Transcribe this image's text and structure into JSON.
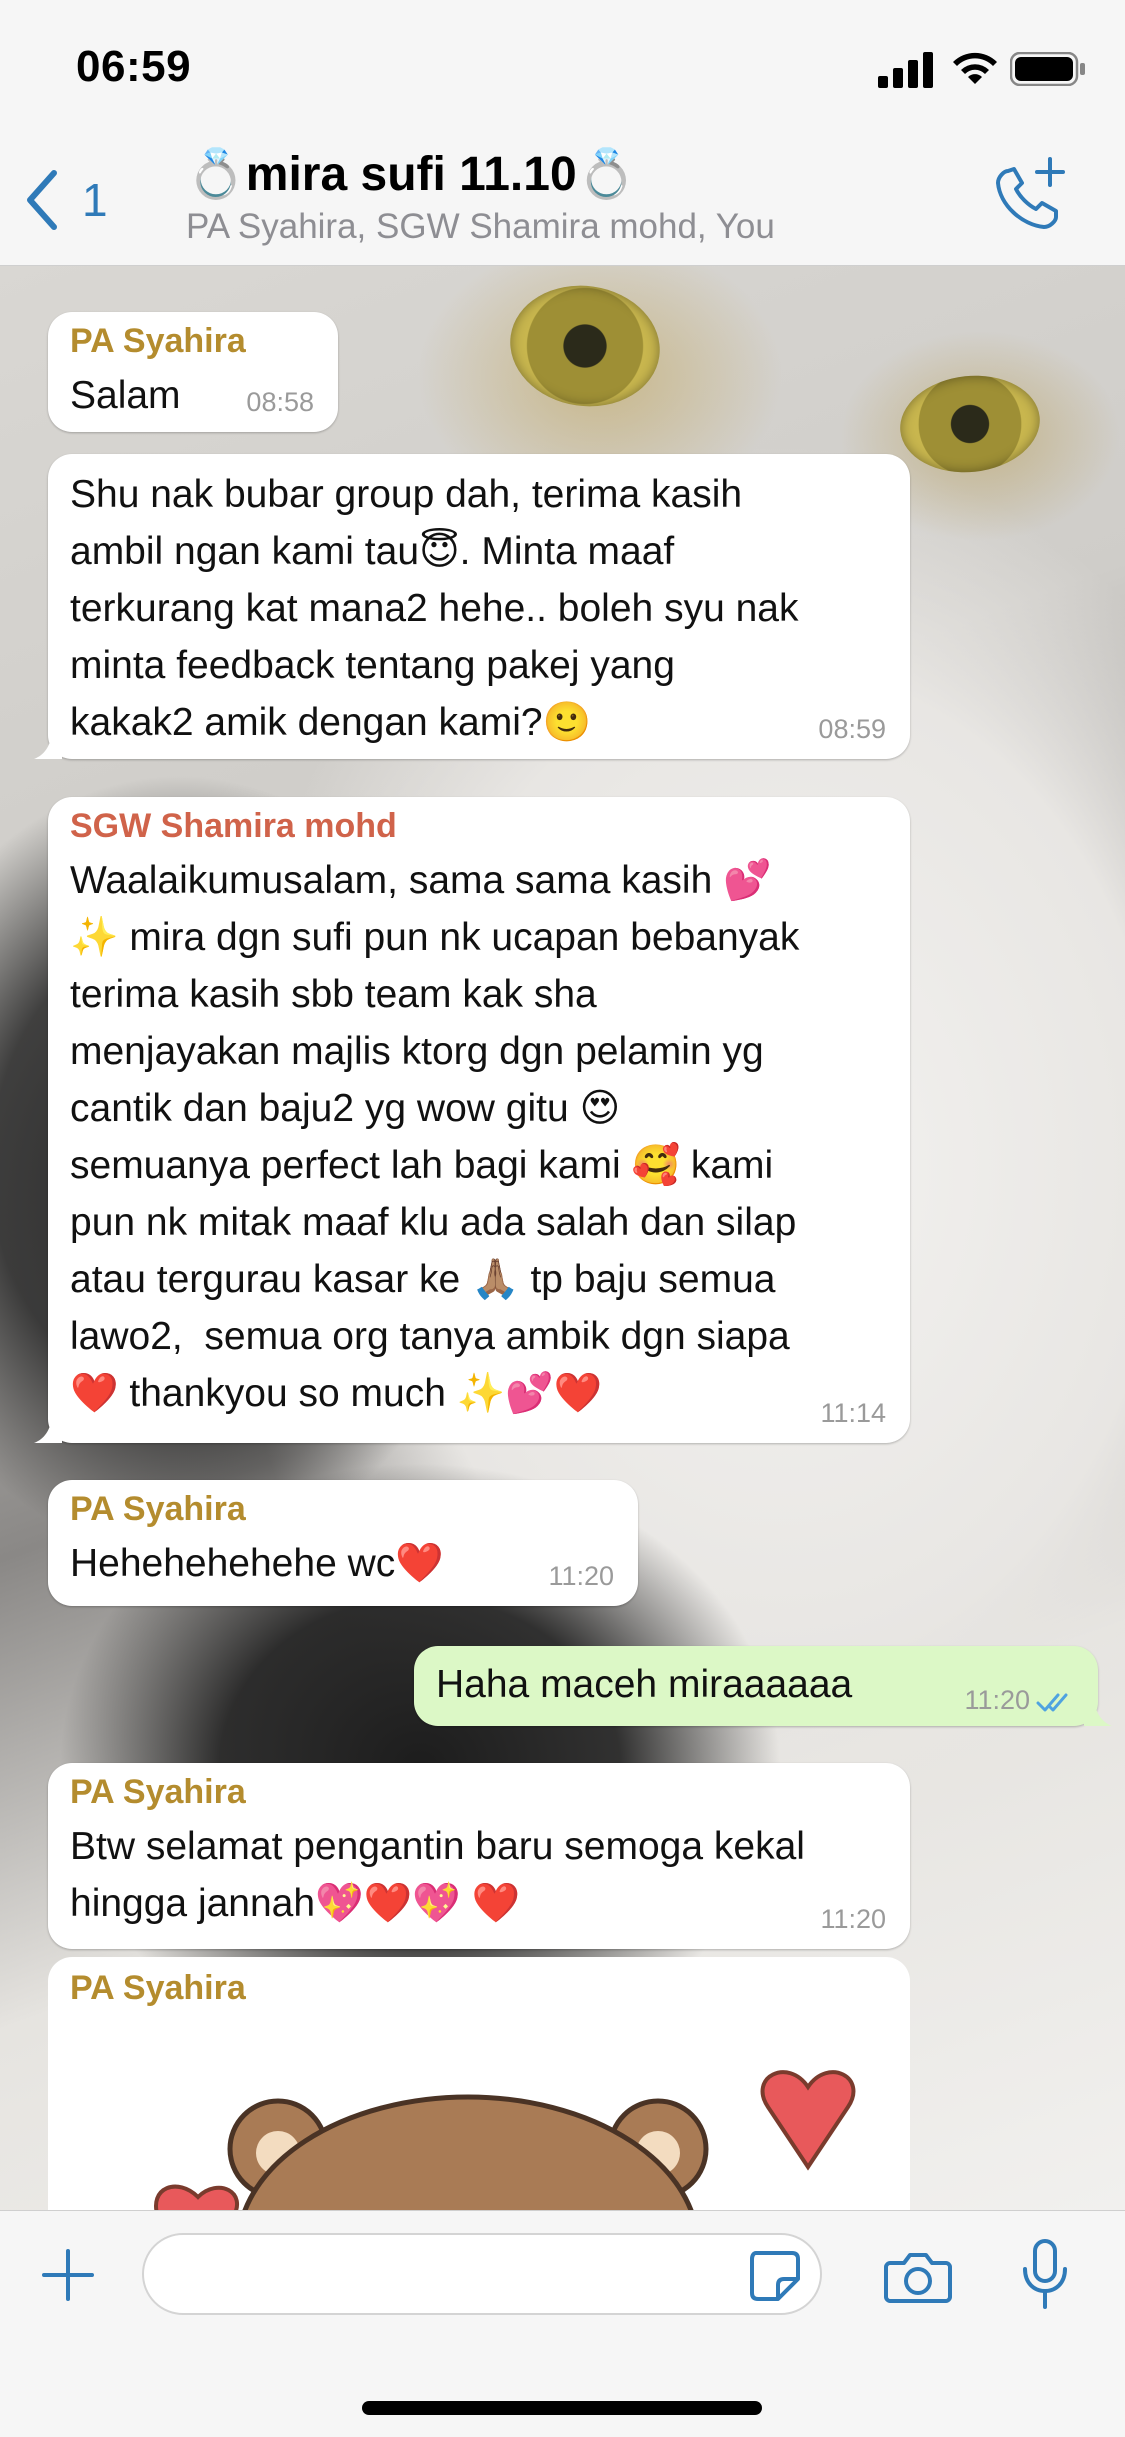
{
  "status_bar": {
    "time": "06:59"
  },
  "header": {
    "back_count": "1",
    "title": "💍mira sufi 11.10💍",
    "subtitle": "PA Syahira, SGW Shamira mohd, You"
  },
  "messages": [
    {
      "sender": "PA Syahira",
      "text": "Salam",
      "time": "08:58"
    },
    {
      "sender": "",
      "text": "Shu nak bubar group dah, terima kasih\nambil ngan kami tau😇. Minta maaf\nterkurang kat mana2 hehe.. boleh syu nak\nminta feedback tentang pakej yang\nkakak2 amik dengan kami?🙂",
      "time": "08:59"
    },
    {
      "sender": "SGW Shamira mohd",
      "text": "Waalaikumusalam, sama sama kasih 💕\n✨ mira dgn sufi pun nk ucapan bebanyak\nterima kasih sbb team kak sha\nmenjayakan majlis ktorg dgn pelamin yg\ncantik dan baju2 yg wow gitu 😍\nsemuanya perfect lah bagi kami 🥰 kami\npun nk mitak maaf klu ada salah dan silap\natau tergurau kasar ke 🙏🏽 tp baju semua\nlawo2,  semua org tanya ambik dgn siapa\n❤️ thankyou so much ✨💕❤️",
      "time": "11:14"
    },
    {
      "sender": "PA Syahira",
      "text": "Hehehehehehe wc❤️",
      "time": "11:20"
    },
    {
      "sender": "You",
      "text": "Haha maceh miraaaaaa",
      "time": "11:20"
    },
    {
      "sender": "PA Syahira",
      "text": "Btw selamat pengantin baru semoga kekal\nhingga jannah💖❤️💖 ❤️",
      "time": "11:20"
    },
    {
      "sender": "PA Syahira",
      "text": "",
      "time": ""
    }
  ],
  "input": {
    "placeholder": ""
  },
  "colors": {
    "accent": "#2f7ab8",
    "sender_pa": "#b48c2e",
    "sender_sgw": "#d0634a",
    "outgoing_bubble": "#dcf8c6",
    "read_check": "#4fa3e0"
  },
  "icons": [
    "chevron-left-icon",
    "call-add-icon",
    "plus-icon",
    "sticker-icon",
    "camera-icon",
    "mic-icon"
  ]
}
